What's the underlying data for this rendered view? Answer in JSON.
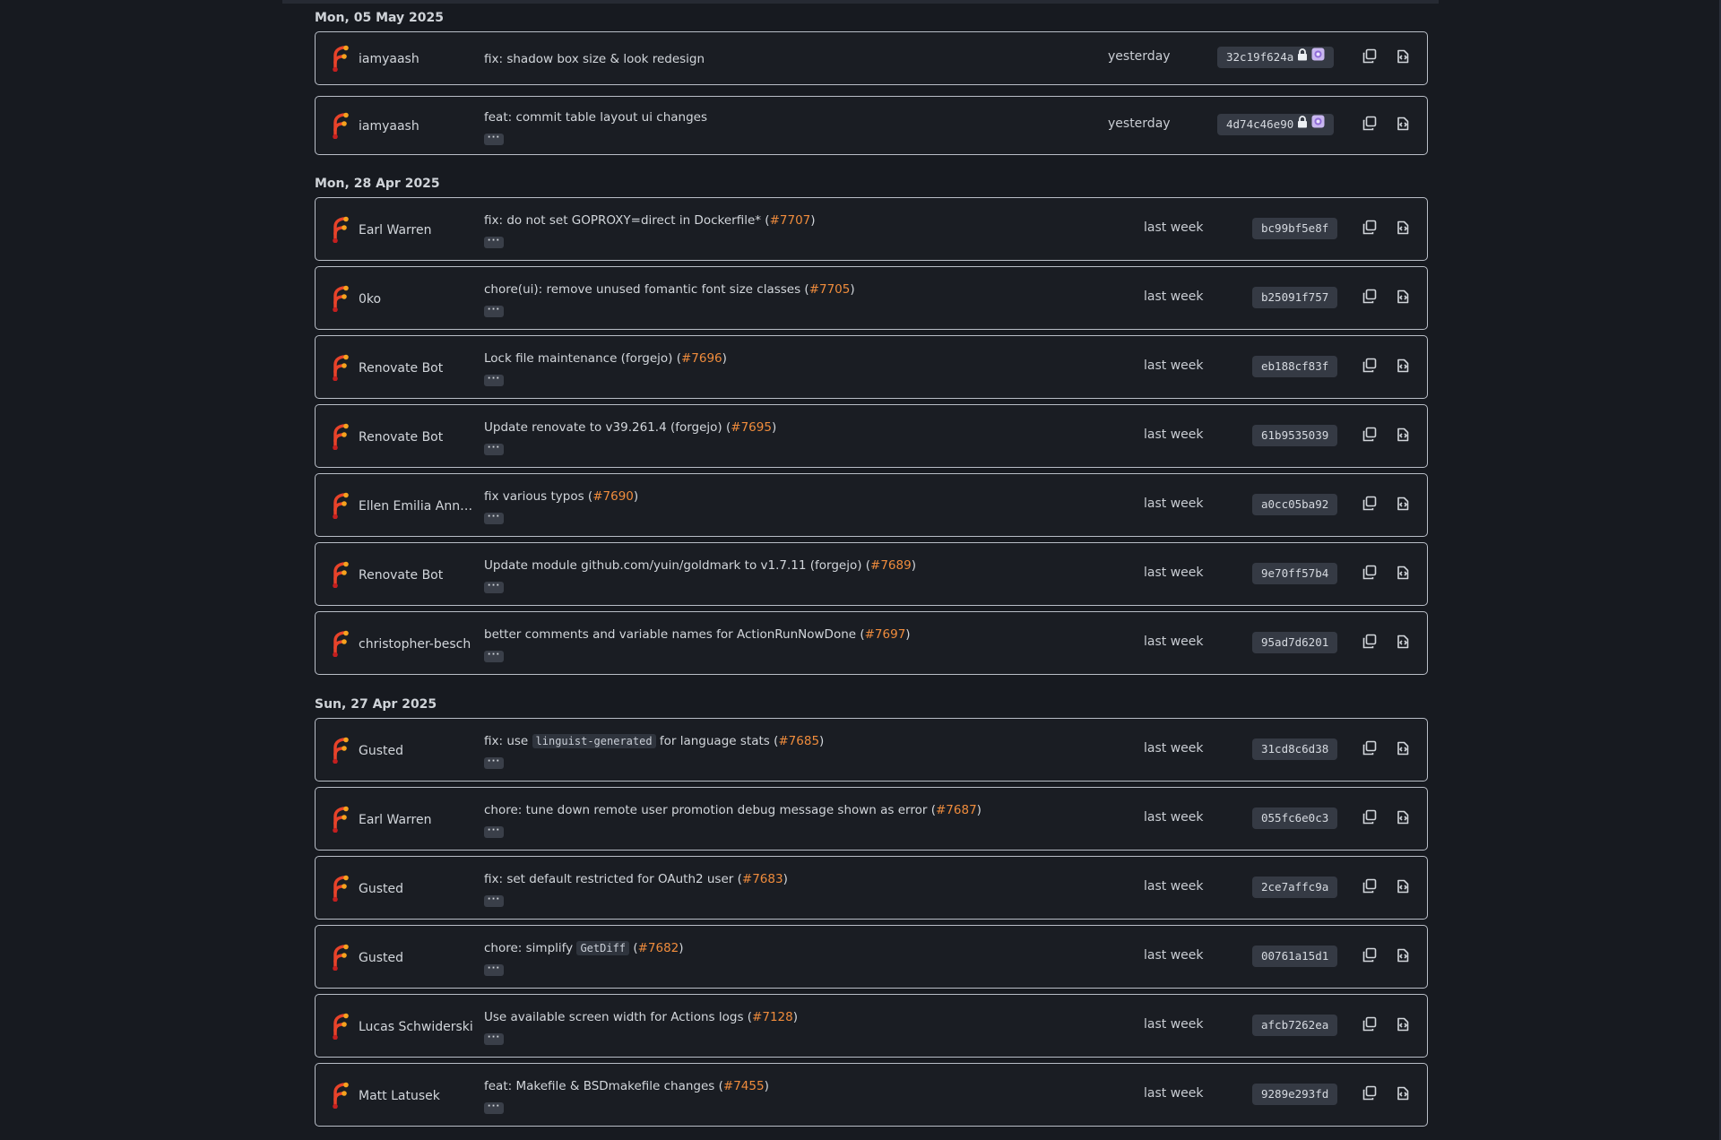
{
  "groups": [
    {
      "date": "Mon, 05 May 2025",
      "commits": [
        {
          "author": "iamyaash",
          "message": "fix: shadow box size & look redesign",
          "when": "yesterday",
          "sha": "32c19f624a",
          "signed": true,
          "ellipsis": false
        },
        {
          "author": "iamyaash",
          "message": "feat: commit table layout ui changes",
          "when": "yesterday",
          "sha": "4d74c46e90",
          "signed": true,
          "ellipsis": true
        }
      ]
    },
    {
      "date": "Mon, 28 Apr 2025",
      "commits": [
        {
          "author": "Earl Warren",
          "message": "fix: do not set GOPROXY=direct in Dockerfile* (",
          "ref": "#7707",
          "message_end": ")",
          "when": "last week",
          "sha": "bc99bf5e8f",
          "ellipsis": true
        },
        {
          "author": "0ko",
          "message": "chore(ui): remove unused fomantic font size classes (",
          "ref": "#7705",
          "message_end": ")",
          "when": "last week",
          "sha": "b25091f757",
          "ellipsis": true
        },
        {
          "author": "Renovate Bot",
          "message": "Lock file maintenance (forgejo) (",
          "ref": "#7696",
          "message_end": ")",
          "when": "last week",
          "sha": "eb188cf83f",
          "ellipsis": true
        },
        {
          "author": "Renovate Bot",
          "message": "Update renovate to v39.261.4 (forgejo) (",
          "ref": "#7695",
          "message_end": ")",
          "when": "last week",
          "sha": "61b9535039",
          "ellipsis": true
        },
        {
          "author": "Ellen Emilia Anna …",
          "message": "fix various typos (",
          "ref": "#7690",
          "message_end": ")",
          "when": "last week",
          "sha": "a0cc05ba92",
          "ellipsis": true
        },
        {
          "author": "Renovate Bot",
          "message": "Update module github.com/yuin/goldmark to v1.7.11 (forgejo) (",
          "ref": "#7689",
          "message_end": ")",
          "when": "last week",
          "sha": "9e70ff57b4",
          "ellipsis": true
        },
        {
          "author": "christopher-besch",
          "message": "better comments and variable names for ActionRunNowDone (",
          "ref": "#7697",
          "message_end": ")",
          "when": "last week",
          "sha": "95ad7d6201",
          "ellipsis": true
        }
      ]
    },
    {
      "date": "Sun, 27 Apr 2025",
      "commits": [
        {
          "author": "Gusted",
          "message": "fix: use ",
          "code": "linguist-generated",
          "message_mid": " for language stats (",
          "ref": "#7685",
          "message_end": ")",
          "when": "last week",
          "sha": "31cd8c6d38",
          "ellipsis": true
        },
        {
          "author": "Earl Warren",
          "message": "chore: tune down remote user promotion debug message shown as error (",
          "ref": "#7687",
          "message_end": ")",
          "when": "last week",
          "sha": "055fc6e0c3",
          "ellipsis": true
        },
        {
          "author": "Gusted",
          "message": "fix: set default restricted for OAuth2 user (",
          "ref": "#7683",
          "message_end": ")",
          "when": "last week",
          "sha": "2ce7affc9a",
          "ellipsis": true
        },
        {
          "author": "Gusted",
          "message": "chore: simplify ",
          "code": "GetDiff",
          "message_mid": " (",
          "ref": "#7682",
          "message_end": ")",
          "when": "last week",
          "sha": "00761a15d1",
          "ellipsis": true
        },
        {
          "author": "Lucas Schwiderski",
          "message": "Use available screen width for Actions logs (",
          "ref": "#7128",
          "message_end": ")",
          "when": "last week",
          "sha": "afcb7262ea",
          "ellipsis": true
        },
        {
          "author": "Matt Latusek",
          "message": "feat: Makefile & BSDmakefile changes (",
          "ref": "#7455",
          "message_end": ")",
          "when": "last week",
          "sha": "9289e293fd",
          "ellipsis": true
        }
      ]
    }
  ],
  "icons": {
    "avatar": "forgejo-logo-icon",
    "copy": "copy-icon",
    "browse": "browse-files-icon",
    "lock": "lock-icon",
    "signature": "verified-signature-icon"
  },
  "colors": {
    "background": "#171a20",
    "row_bg": "#1a1d23",
    "row_border": "#b9bec7",
    "ref_link": "#f08c3c",
    "sha_bg": "#353a44"
  },
  "ellipsis_label": "···"
}
